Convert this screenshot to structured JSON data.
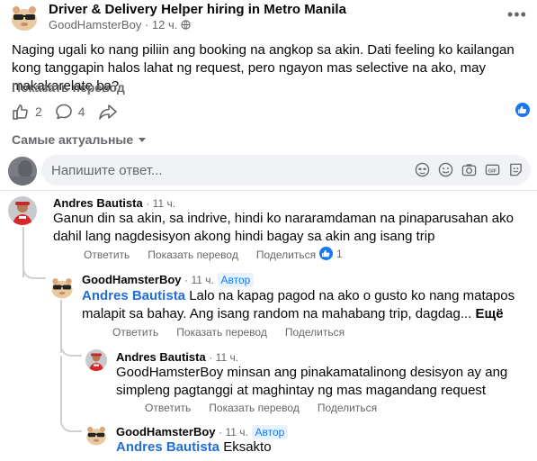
{
  "post": {
    "group_name": "Driver & Delivery Helper hiring in Metro Manila",
    "author": "GoodHamsterBoy",
    "separator": "·",
    "time": "12 ч.",
    "text": "Naging ugali ko nang piliin ang booking na angkop sa akin. Dati feeling ko kailangan kong tanggapin halos lahat ng request, pero ngayon mas selective na ako, may makakarelate ba?",
    "see_translation": "Показать перевод",
    "likes": "2",
    "comments": "4"
  },
  "sort": {
    "label": "Самые актуальные"
  },
  "composer": {
    "placeholder": "Напишите ответ..."
  },
  "comments": [
    {
      "name": "Andres Bautista",
      "time": "11 ч.",
      "text": "Ganun din sa akin, sa indrive, hindi ko nararamdaman na pinaparusahan ako dahil lang nagdesisyon akong hindi bagay sa akin ang isang trip",
      "reply": "Ответить",
      "translate": "Показать перевод",
      "share": "Поделиться",
      "reaction_count": "1"
    },
    {
      "name": "GoodHamsterBoy",
      "time": "11 ч.",
      "badge": "Автор",
      "mention": "Andres Bautista",
      "text": " Lalo na kapag pagod na ako o gusto ko nang matapos malapit sa bahay. Ang isang random na mahabang trip, dagdag...",
      "more": " Ещё",
      "reply": "Ответить",
      "translate": "Показать перевод",
      "share": "Поделиться"
    },
    {
      "name": "Andres Bautista",
      "time": "11 ч.",
      "text": "GoodHamsterBoy minsan ang pinakamatalinong desisyon ay ang simpleng pagtanggi at maghintay ng mas magandang request",
      "reply": "Ответить",
      "translate": "Показать перевод",
      "share": "Поделиться"
    },
    {
      "name": "GoodHamsterBoy",
      "time": "11 ч.",
      "badge": "Автор",
      "mention": "Andres Bautista",
      "text": " Eksakto"
    }
  ],
  "colors": {
    "accent": "#1877f2",
    "muted": "#65676b",
    "mention": "#216fdb"
  }
}
